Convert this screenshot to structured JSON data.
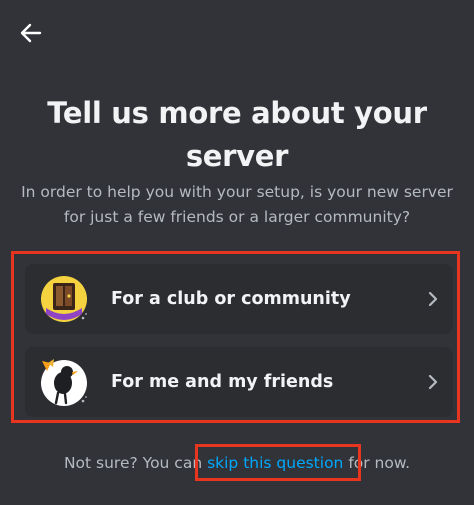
{
  "header": {
    "back_icon": "arrow-left-icon"
  },
  "title": "Tell us more about your server",
  "subtitle": "In order to help you with your setup, is your new server for just a few friends or a larger community?",
  "options": [
    {
      "label": "For a club or community",
      "icon": "club-community-illustration-icon",
      "chevron": "chevron-right-icon"
    },
    {
      "label": "For me and my friends",
      "icon": "me-and-friends-illustration-icon",
      "chevron": "chevron-right-icon"
    }
  ],
  "footer": {
    "prefix": "Not sure? You can ",
    "link": "skip this question",
    "suffix": " for now."
  },
  "colors": {
    "background": "#313338",
    "card": "#2b2d31",
    "title_text": "#f2f3f5",
    "body_text": "#b5bac1",
    "link": "#00a8fc",
    "highlight_box": "#e8351f"
  }
}
